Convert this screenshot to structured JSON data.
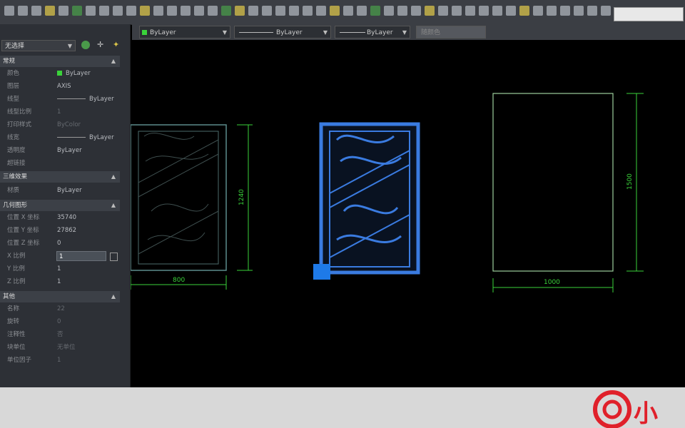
{
  "toolbar": {
    "search_value": ""
  },
  "propbar": {
    "layer": "ByLayer",
    "linetype": "ByLayer",
    "lineweight": "ByLayer",
    "plotstyle": "随颜色"
  },
  "panel": {
    "selector": "无选择",
    "sections": {
      "general": "常规",
      "threed": "三维效果",
      "geometry": "几何图形",
      "misc": "其他"
    },
    "general_rows": [
      {
        "key": "颜色",
        "value": "ByLayer"
      },
      {
        "key": "图层",
        "value": "AXIS"
      },
      {
        "key": "线型",
        "value": "ByLayer"
      },
      {
        "key": "线型比例",
        "value": "1"
      },
      {
        "key": "打印样式",
        "value": "ByColor"
      },
      {
        "key": "线宽",
        "value": "ByLayer"
      },
      {
        "key": "透明度",
        "value": "ByLayer"
      },
      {
        "key": "超链接",
        "value": ""
      }
    ],
    "threed_rows": [
      {
        "key": "材质",
        "value": "ByLayer"
      }
    ],
    "geometry_rows": [
      {
        "key": "位置 X 坐标",
        "value": "35740"
      },
      {
        "key": "位置 Y 坐标",
        "value": "27862"
      },
      {
        "key": "位置 Z 坐标",
        "value": "0"
      },
      {
        "key": "X 比例",
        "value": "1"
      },
      {
        "key": "Y 比例",
        "value": "1"
      },
      {
        "key": "Z 比例",
        "value": "1"
      }
    ],
    "misc_rows": [
      {
        "key": "名称",
        "value": "22"
      },
      {
        "key": "旋转",
        "value": "0"
      },
      {
        "key": "注释性",
        "value": "否"
      },
      {
        "key": "块单位",
        "value": "无单位"
      },
      {
        "key": "单位因子",
        "value": "1"
      }
    ]
  },
  "drawing": {
    "dims": {
      "left_width": "800",
      "left_height": "1240",
      "right_width": "1000",
      "right_height": "1500"
    },
    "colors": {
      "dimension": "#3ad23a",
      "selected": "#3a7be0",
      "outline": "#9ccf9c"
    }
  },
  "watermark": {
    "text": "小"
  }
}
